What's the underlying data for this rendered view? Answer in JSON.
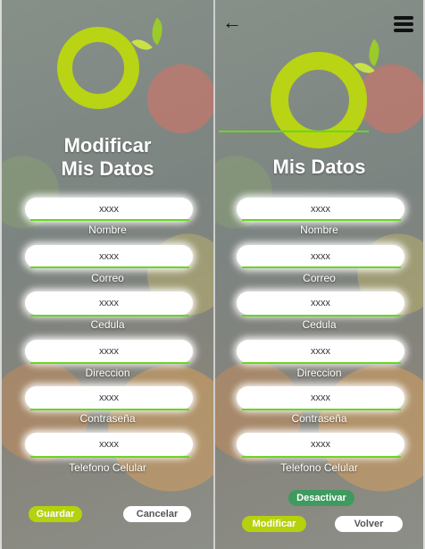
{
  "left": {
    "title_line1": "Modificar",
    "title_line2": "Mis Datos",
    "fields": [
      {
        "value": "xxxx",
        "label": "Nombre"
      },
      {
        "value": "xxxx",
        "label": "Correo"
      },
      {
        "value": "xxxx",
        "label": "Cedula"
      },
      {
        "value": "xxxx",
        "label": "Direccion"
      },
      {
        "value": "xxxx",
        "label": "Contraseña"
      },
      {
        "value": "xxxx",
        "label": "Telefono Celular"
      }
    ],
    "save_label": "Guardar",
    "cancel_label": "Cancelar"
  },
  "right": {
    "back_icon": "←",
    "title": "Mis Datos",
    "fields": [
      {
        "value": "xxxx",
        "label": "Nombre"
      },
      {
        "value": "xxxx",
        "label": "Correo"
      },
      {
        "value": "xxxx",
        "label": "Cedula"
      },
      {
        "value": "xxxx",
        "label": "Direccion"
      },
      {
        "value": "xxxx",
        "label": "Contraseña"
      },
      {
        "value": "xxxx",
        "label": "Telefono Celular"
      }
    ],
    "deactivate_label": "Desactivar",
    "modify_label": "Modificar",
    "back_label": "Volver"
  },
  "colors": {
    "accent": "#b6d10e",
    "underline": "#69d61f",
    "deactivate": "#3f9a5f"
  },
  "icons": [
    "back-arrow-icon",
    "hamburger-menu-icon",
    "logo-ring-icon",
    "leaf-icon"
  ]
}
